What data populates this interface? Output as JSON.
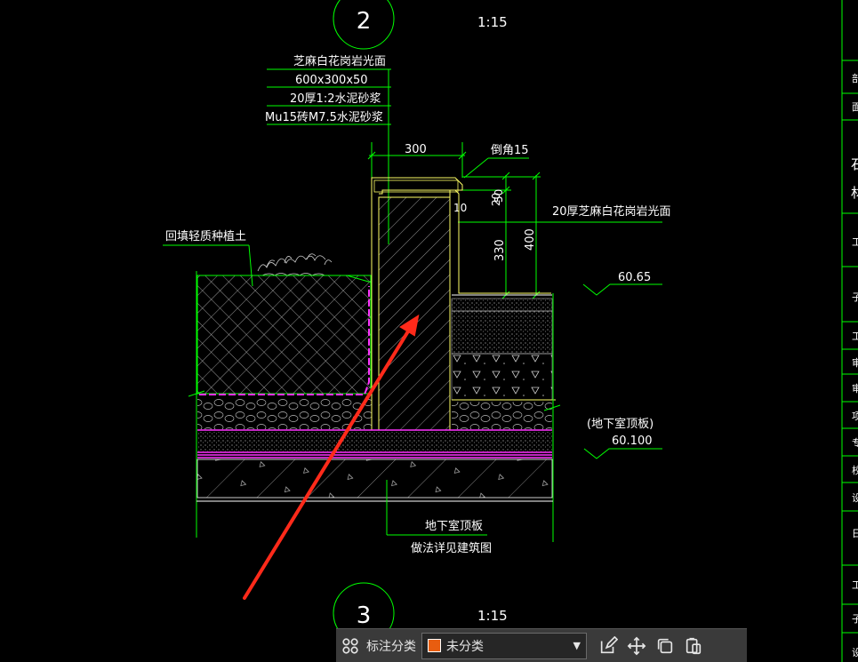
{
  "drawing": {
    "detail_2_number": "2",
    "detail_2_scale": "1:15",
    "detail_3_number": "3",
    "detail_3_scale": "1:15",
    "callout_top_lines": [
      "芝麻白花岗岩光面",
      "600x300x50",
      "20厚1:2水泥砂浆",
      "Mu15砖M7.5水泥砂浆"
    ],
    "dim_300": "300",
    "chamfer_label": "倒角15",
    "dim_50": "50",
    "dim_20": "20",
    "dim_10": "10",
    "dim_330": "330",
    "dim_400": "400",
    "granite_face_label": "20厚芝麻白花岗岩光面",
    "backfill_label": "回填轻质种植土",
    "elev_1": "60.65",
    "basement_roof_paren": "(地下室顶板)",
    "elev_2": "60.100",
    "bottom_callout_lines": [
      "地下室顶板",
      "做法详见建筑图"
    ],
    "sidebar_glyphs": [
      "剖",
      "面",
      "石",
      "材",
      "工",
      "子",
      "工",
      "审",
      "审",
      "项",
      "专",
      "校",
      "设",
      "日",
      "工",
      "子",
      "设"
    ]
  },
  "toolbar": {
    "label": "标注分类",
    "selected_category": "未分类",
    "swatch_color": "#e85d10"
  },
  "colors": {
    "line_white": "#ffffff",
    "line_green": "#00ff00",
    "line_yellow": "#ffff66",
    "line_magenta": "#ff33ff",
    "arrow_red": "#ff2a1a"
  }
}
